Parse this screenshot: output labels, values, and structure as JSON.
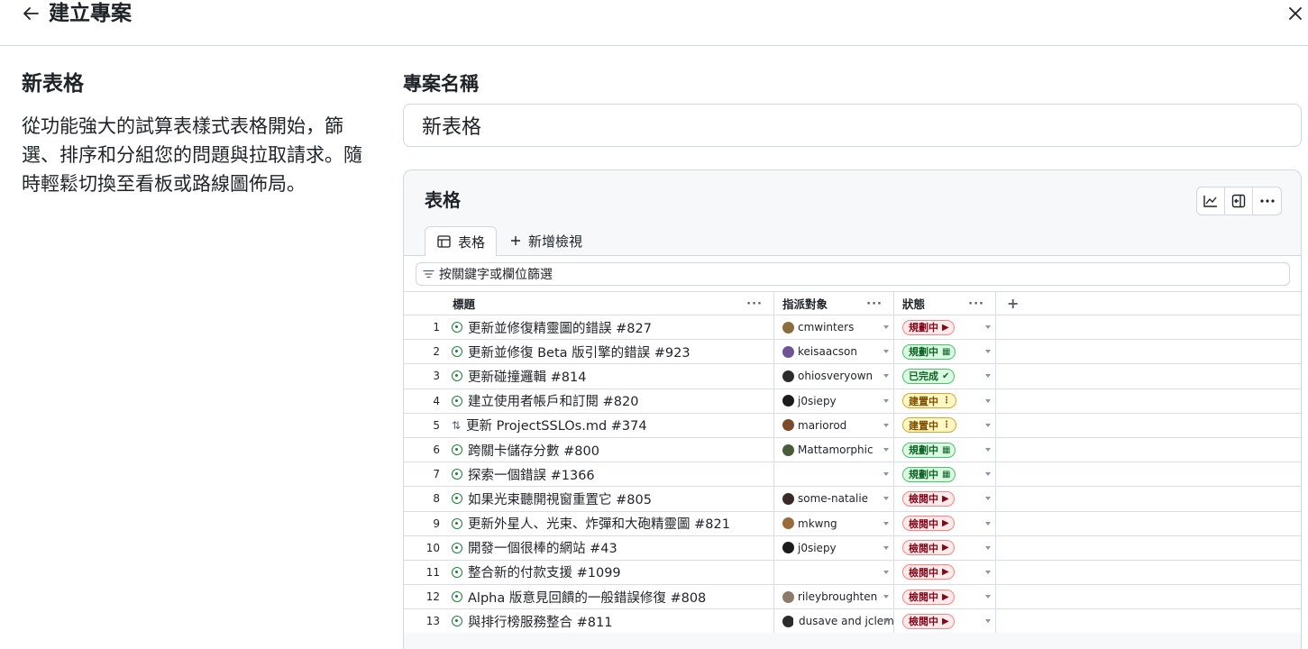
{
  "header": {
    "title": "建立專案",
    "back_icon": "arrow-left-icon",
    "close_icon": "close-icon"
  },
  "template": {
    "name": "新表格",
    "description": "從功能強大的試算表樣式表格開始，篩選、排序和分組您的問題與拉取請求。隨時輕鬆切換至看板或路線圖佈局。"
  },
  "project_name": {
    "label": "專案名稱",
    "value": "新表格"
  },
  "preview": {
    "title": "表格",
    "toolbar_icons": [
      "chart-icon",
      "sidebar-panel-icon",
      "more-options-icon"
    ],
    "tabs": [
      {
        "label": "表格",
        "icon": "table-icon"
      },
      {
        "label": "新增檢視",
        "icon": "plus-icon"
      }
    ],
    "filter_placeholder": "按關鍵字或欄位篩選",
    "columns": {
      "title": "標題",
      "assignee": "指派對象",
      "status": "狀態",
      "more": "···",
      "add": "+"
    },
    "rows": [
      {
        "num": "1",
        "type": "issue",
        "title": "更新並修復精靈圖的錯誤 #827",
        "assignee": "cmwinters",
        "avatar_color": "#8a6d3b",
        "status": "規劃中",
        "status_color": "red",
        "status_icon": "flag-icon"
      },
      {
        "num": "2",
        "type": "issue",
        "title": "更新並修復 Beta 版引擎的錯誤 #923",
        "assignee": "keisaacson",
        "avatar_color": "#6e5494",
        "status": "規劃中",
        "status_color": "green",
        "status_icon": "calendar-icon"
      },
      {
        "num": "3",
        "type": "issue",
        "title": "更新碰撞邏輯 #814",
        "assignee": "ohiosveryown",
        "avatar_color": "#2d2d2d",
        "status": "已完成",
        "status_color": "green",
        "status_icon": "check-icon"
      },
      {
        "num": "4",
        "type": "issue",
        "title": "建立使用者帳戶和訂閱 #820",
        "assignee": "j0siepy",
        "avatar_color": "#1b1b1b",
        "status": "建置中",
        "status_color": "yellow",
        "status_icon": "construction-icon"
      },
      {
        "num": "5",
        "type": "pr",
        "title": "更新 ProjectSSLOs.md #374",
        "assignee": "mariorod",
        "avatar_color": "#7a4a2b",
        "status": "建置中",
        "status_color": "yellow",
        "status_icon": "construction-icon"
      },
      {
        "num": "6",
        "type": "issue",
        "title": "跨關卡儲存分數 #800",
        "assignee": "Mattamorphic",
        "avatar_color": "#4b5a3a",
        "status": "規劃中",
        "status_color": "green",
        "status_icon": "calendar-icon"
      },
      {
        "num": "7",
        "type": "issue",
        "title": "探索一個錯誤 #1366",
        "assignee": "",
        "avatar_color": "",
        "status": "規劃中",
        "status_color": "green",
        "status_icon": "calendar-icon"
      },
      {
        "num": "8",
        "type": "issue",
        "title": "如果光束聽開視窗重置它 #805",
        "assignee": "some-natalie",
        "avatar_color": "#3a2a2a",
        "status": "檢閱中",
        "status_color": "red",
        "status_icon": "flag-icon"
      },
      {
        "num": "9",
        "type": "issue",
        "title": "更新外星人、光束、炸彈和大砲精靈圖 #821",
        "assignee": "mkwng",
        "avatar_color": "#9a6a3a",
        "status": "檢閱中",
        "status_color": "red",
        "status_icon": "flag-icon"
      },
      {
        "num": "10",
        "type": "issue",
        "title": "開發一個很棒的網站 #43",
        "assignee": "j0siepy",
        "avatar_color": "#1b1b1b",
        "status": "檢閱中",
        "status_color": "red",
        "status_icon": "flag-icon"
      },
      {
        "num": "11",
        "type": "issue",
        "title": "整合新的付款支援 #1099",
        "assignee": "",
        "avatar_color": "",
        "status": "檢閱中",
        "status_color": "red",
        "status_icon": "flag-icon"
      },
      {
        "num": "12",
        "type": "issue",
        "title": "Alpha 版意見回饋的一般錯誤修復 #808",
        "assignee": "rileybroughten",
        "avatar_color": "#8c7b6b",
        "status": "檢閱中",
        "status_color": "red",
        "status_icon": "flag-icon"
      },
      {
        "num": "13",
        "type": "issue",
        "title": "與排行榜服務整合 #811",
        "assignee": "dusave and jclem",
        "avatar_color": "#2b2b2b",
        "avatar_color_2": "#5a3a2a",
        "status": "檢閱中",
        "status_color": "red",
        "status_icon": "flag-icon"
      }
    ]
  }
}
